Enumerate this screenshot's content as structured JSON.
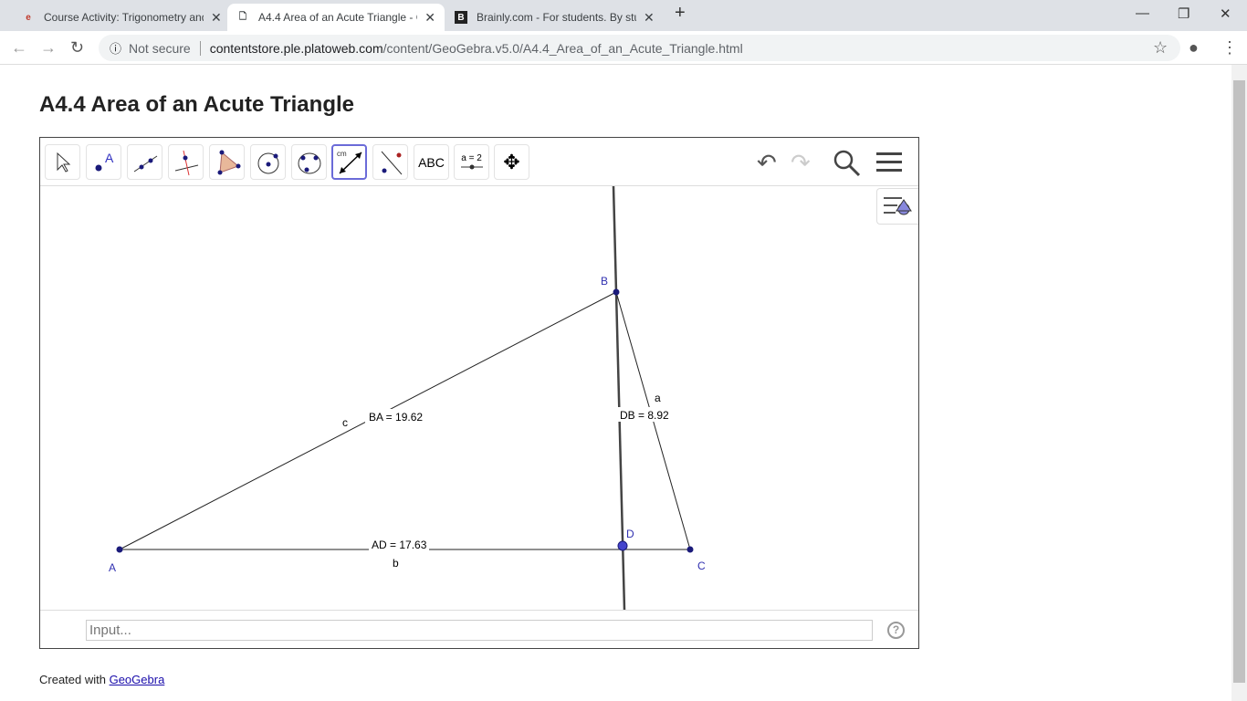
{
  "browser": {
    "tabs": [
      {
        "title": "Course Activity: Trigonometry and",
        "icon": "edmentum-icon"
      },
      {
        "title": "A4.4 Area of an Acute Triangle - C",
        "icon": "page-icon"
      },
      {
        "title": "Brainly.com - For students. By stu",
        "icon": "brainly-icon"
      }
    ],
    "security": "Not secure",
    "url_host": "contentstore.ple.platoweb.com",
    "url_path": "/content/GeoGebra.v5.0/A4.4_Area_of_an_Acute_Triangle.html"
  },
  "page": {
    "title": "A4.4 Area of an Acute Triangle",
    "footer_text": "Created with ",
    "footer_link": "GeoGebra"
  },
  "toolbar": {
    "tools": [
      "move",
      "point",
      "line",
      "perpendicular-line",
      "polygon",
      "circle-center-point",
      "circle-three-points",
      "distance",
      "reflect",
      "text",
      "slider",
      "move-graphics-view"
    ],
    "text_label": "ABC",
    "slider_label": "a = 2",
    "distance_label": "cm"
  },
  "geometry": {
    "points": {
      "A": "A",
      "B": "B",
      "C": "C",
      "D": "D"
    },
    "segments": {
      "a": "a",
      "b": "b",
      "c": "c"
    },
    "measurements": {
      "BA": "BA = 19.62",
      "AD": "AD = 17.63",
      "DB": "DB = 8.92"
    }
  },
  "input": {
    "placeholder": "Input..."
  },
  "help": "?"
}
